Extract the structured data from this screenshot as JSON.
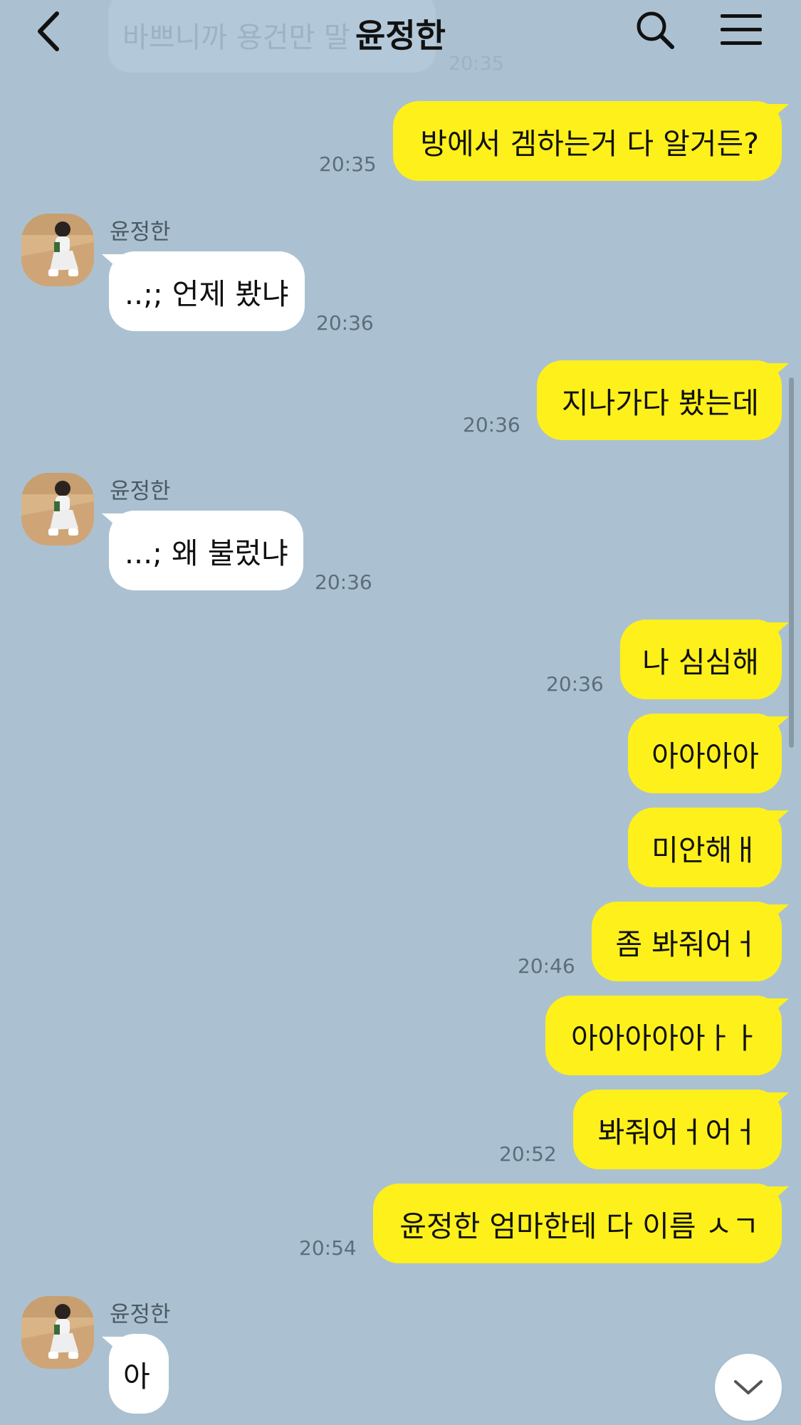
{
  "header": {
    "title": "윤정한",
    "back_icon": "chevron-left-icon",
    "search_icon": "search-icon",
    "menu_icon": "hamburger-menu-icon"
  },
  "ghost": {
    "text": "바쁘니까 용건만 말",
    "time": "20:35"
  },
  "contact": {
    "name": "윤정한"
  },
  "messages": [
    {
      "side": "me",
      "text": "방에서 겜하는거 다 알거든?",
      "time": "20:35"
    },
    {
      "side": "them",
      "sender": "윤정한",
      "text": "..;; 언제 봤냐",
      "time": "20:36"
    },
    {
      "side": "me",
      "text": "지나가다 봤는데",
      "time": "20:36"
    },
    {
      "side": "them",
      "sender": "윤정한",
      "text": "...; 왜 불렀냐",
      "time": "20:36"
    },
    {
      "side": "me",
      "text": "나 심심해",
      "time": "20:36"
    },
    {
      "side": "me",
      "text": "아아아아",
      "time": ""
    },
    {
      "side": "me",
      "text": "미안해ㅐ",
      "time": ""
    },
    {
      "side": "me",
      "text": "좀 봐줘어ㅓ",
      "time": "20:46"
    },
    {
      "side": "me",
      "text": "아아아아아ㅏㅏ",
      "time": ""
    },
    {
      "side": "me",
      "text": "봐줘어ㅓ어ㅓ",
      "time": "20:52"
    },
    {
      "side": "me",
      "text": "윤정한 엄마한테 다 이름 ㅅㄱ",
      "time": "20:54"
    },
    {
      "side": "them",
      "sender": "윤정한",
      "text": "아",
      "time": ""
    }
  ],
  "scroll_down_icon": "chevron-down-icon",
  "colors": {
    "background": "#abc1d1",
    "my_bubble": "#fef01b",
    "their_bubble": "#ffffff"
  }
}
